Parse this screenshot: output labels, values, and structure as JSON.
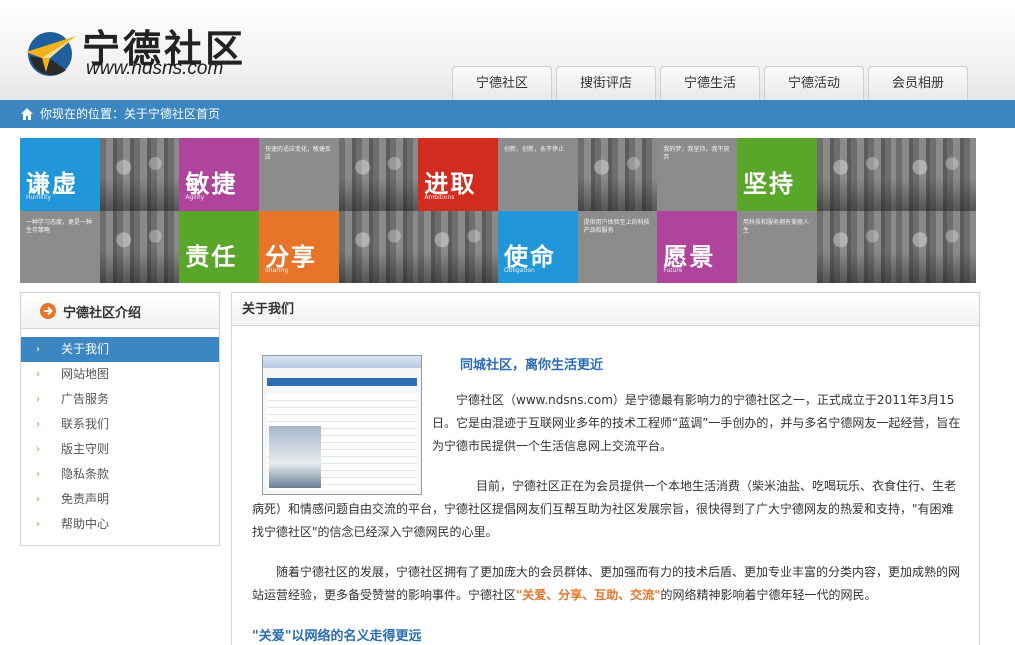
{
  "header": {
    "logo_title": "宁德社区",
    "logo_url": "www.ndsns.com"
  },
  "nav": {
    "tabs": [
      "宁德社区",
      "搜街评店",
      "宁德生活",
      "宁德活动",
      "会员相册"
    ]
  },
  "breadcrumb": {
    "text": "你现在的位置：关于宁德社区首页"
  },
  "banner": {
    "tiles": [
      {
        "big": "谦虚",
        "small": "Humility",
        "color": "#2196d8"
      },
      {
        "big": "",
        "small": "",
        "color": "photo"
      },
      {
        "big": "敏捷",
        "small": "Agility",
        "color": "#b0439b"
      },
      {
        "big": "",
        "small": "快速的适应变化，敏捷反应",
        "color": "#8c8c8c"
      },
      {
        "big": "",
        "small": "",
        "color": "photo"
      },
      {
        "big": "进取",
        "small": "Ambitions",
        "color": "#d22b1f"
      },
      {
        "big": "",
        "small": "创新，创新，永不停止",
        "color": "#8c8c8c"
      },
      {
        "big": "",
        "small": "",
        "color": "photo"
      },
      {
        "big": "",
        "small": "我的梦，我坚持，我不放弃",
        "color": "#8c8c8c"
      },
      {
        "big": "坚持",
        "small": "",
        "color": "#5aa62b"
      },
      {
        "big": "",
        "small": "",
        "color": "photo"
      },
      {
        "big": "",
        "small": "",
        "color": "photo"
      },
      {
        "big": "",
        "small": "一种学习态度，更是一种生存策略",
        "color": "#8c8c8c"
      },
      {
        "big": "",
        "small": "",
        "color": "photo"
      },
      {
        "big": "责任",
        "small": "",
        "color": "#5aa62b"
      },
      {
        "big": "分享",
        "small": "Sharing",
        "color": "#e8742a"
      },
      {
        "big": "",
        "small": "",
        "color": "photo"
      },
      {
        "big": "",
        "small": "",
        "color": "photo"
      },
      {
        "big": "使命",
        "small": "Obligation",
        "color": "#2196d8"
      },
      {
        "big": "",
        "small": "提供用户体验至上的科技产品和服务",
        "color": "#8c8c8c"
      },
      {
        "big": "愿景",
        "small": "Future",
        "color": "#b0439b"
      },
      {
        "big": "",
        "small": "用科技和服务拥有美丽人生",
        "color": "#8c8c8c"
      },
      {
        "big": "",
        "small": "",
        "color": "photo"
      },
      {
        "big": "",
        "small": "",
        "color": "photo"
      }
    ]
  },
  "sidebar": {
    "title": "宁德社区介绍",
    "items": [
      "关于我们",
      "网站地图",
      "广告服务",
      "联系我们",
      "版主守则",
      "隐私条款",
      "免责声明",
      "帮助中心"
    ]
  },
  "main": {
    "title": "关于我们",
    "subtitle": "同城社区，离你生活更近",
    "para1": "宁德社区（www.ndsns.com）是宁德最有影响力的宁德社区之一，正式成立于2011年3月15日。它是由混迹于互联网业多年的技术工程师“蓝调”一手创办的，并与多名宁德网友一起经营，旨在为宁德市民提供一个生活信息网上交流平台。",
    "para2": "目前，宁德社区正在为会员提供一个本地生活消费（柴米油盐、吃喝玩乐、衣食住行、生老病死）和情感问题自由交流的平台，宁德社区提倡网友们互帮互助为社区发展宗旨，很快得到了广大宁德网友的热爱和支持，\"有困难找宁德社区\"的信念已经深入宁德网民的心里。",
    "para3_pre": "随着宁德社区的发展，宁德社区拥有了更加庞大的会员群体、更加强而有力的技术后盾、更加专业丰富的分类内容，更加成熟的网站运营经验，更多备受赞誉的影响事件。宁德社区",
    "para3_hl": "\"关爱、分享、互助、交流\"",
    "para3_post": "的网络精神影响着宁德年轻一代的网民。",
    "sub2": "\"关爱\"以网络的名义走得更远"
  }
}
